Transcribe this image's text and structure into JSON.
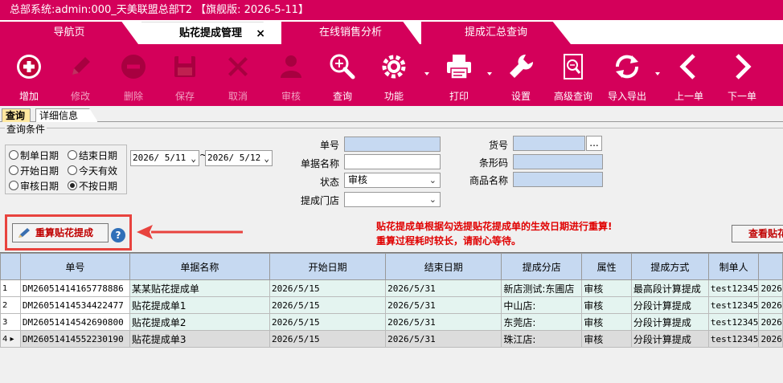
{
  "window": {
    "title": "总部系统:admin:000_天美联盟总部T2      【旗舰版: 2026-5-11】"
  },
  "tabs": [
    {
      "label": "导航页"
    },
    {
      "label": "贴花提成管理",
      "close": "×"
    },
    {
      "label": "在线销售分析"
    },
    {
      "label": "提成汇总查询"
    }
  ],
  "toolbar": [
    {
      "label": "增加",
      "icon": "plus-circle-icon"
    },
    {
      "label": "修改",
      "icon": "pencil-icon"
    },
    {
      "label": "删除",
      "icon": "minus-circle-icon"
    },
    {
      "label": "保存",
      "icon": "floppy-disk-icon"
    },
    {
      "label": "取消",
      "icon": "x-icon"
    },
    {
      "label": "审核",
      "icon": "person-icon"
    },
    {
      "label": "查询",
      "icon": "magnifier-icon"
    },
    {
      "label": "功能",
      "icon": "gear-icon"
    },
    {
      "label": "打印",
      "icon": "printer-icon"
    },
    {
      "label": "设置",
      "icon": "wrench-icon"
    },
    {
      "label": "高级查询",
      "icon": "document-search-icon"
    },
    {
      "label": "导入导出",
      "icon": "refresh-icon"
    },
    {
      "label": "上一单",
      "icon": "chevron-left-icon"
    },
    {
      "label": "下一单",
      "icon": "chevron-right-icon"
    }
  ],
  "subtabs": [
    "查询",
    "详细信息"
  ],
  "query": {
    "legend": "查询条件",
    "radios": [
      "制单日期",
      "结束日期",
      "开始日期",
      "今天有效",
      "审核日期",
      "不按日期"
    ],
    "selected_radio": "不按日期",
    "date_from": "2026/ 5/11",
    "date_sep": "~",
    "date_to": "2026/ 5/12",
    "fields": {
      "doc_no": {
        "label": "单号",
        "value": ""
      },
      "doc_name": {
        "label": "单据名称",
        "value": ""
      },
      "status": {
        "label": "状态",
        "value": "审核"
      },
      "store": {
        "label": "提成门店",
        "value": ""
      },
      "item_no": {
        "label": "货号",
        "value": "",
        "browse": "..."
      },
      "barcode": {
        "label": "条形码",
        "value": ""
      },
      "product_name": {
        "label": "商品名称",
        "value": ""
      }
    }
  },
  "recalc": {
    "button": "重算贴花提成",
    "help": "?",
    "note1": "贴花提成单根据勾选提贴花提成单的生效日期进行重算!",
    "note2": "重算过程耗时较长，请耐心等待。",
    "view_button": "查看贴花"
  },
  "grid": {
    "columns": [
      "",
      "单号",
      "单据名称",
      "开始日期",
      "结束日期",
      "提成分店",
      "属性",
      "提成方式",
      "制单人",
      ""
    ],
    "rows": [
      [
        "1",
        "DM26051414165778886",
        "某某贴花提成单",
        "2026/5/15",
        "2026/5/31",
        "新店测试:东圃店",
        "审核",
        "最高段计算提成",
        "test12345",
        "2026"
      ],
      [
        "2",
        "DM26051414534422477",
        "贴花提成单1",
        "2026/5/15",
        "2026/5/31",
        "中山店:",
        "审核",
        "分段计算提成",
        "test12345",
        "2026"
      ],
      [
        "3",
        "DM26051414542690800",
        "贴花提成单2",
        "2026/5/15",
        "2026/5/31",
        "东莞店:",
        "审核",
        "分段计算提成",
        "test12345",
        "2026"
      ],
      [
        "4 ▸",
        "DM26051414552230190",
        "贴花提成单3",
        "2026/5/15",
        "2026/5/31",
        "珠江店:",
        "审核",
        "分段计算提成",
        "test12345",
        "2026"
      ]
    ]
  }
}
